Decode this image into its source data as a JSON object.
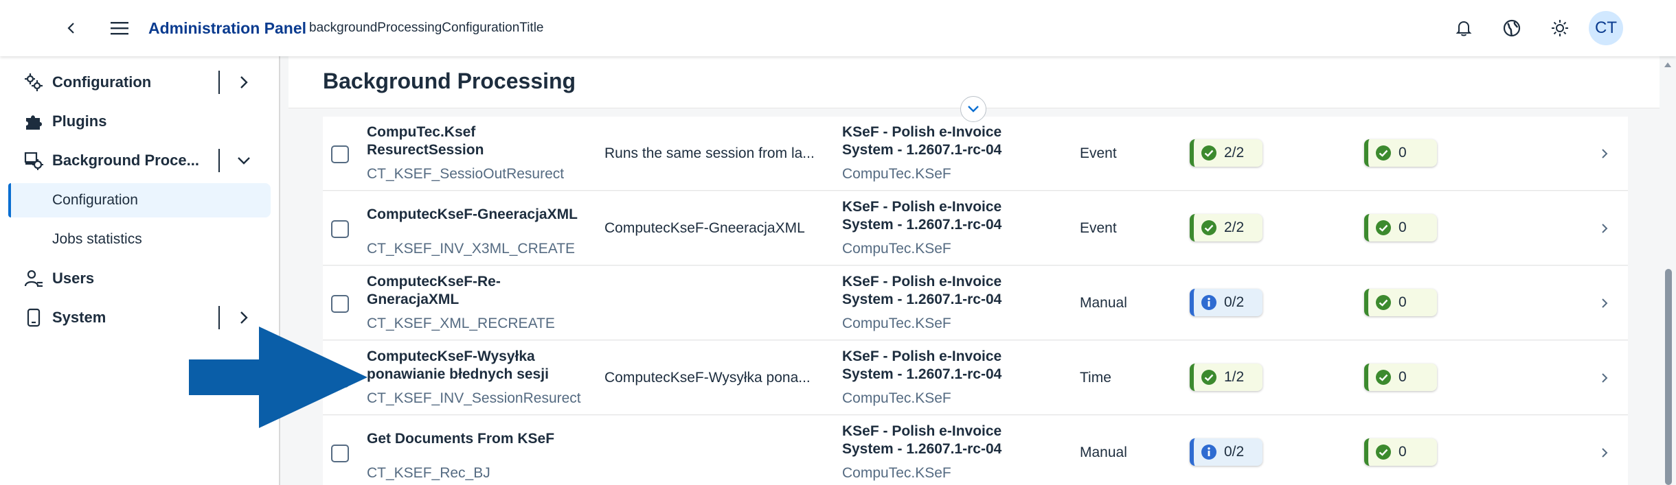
{
  "header": {
    "title": "Administration Panel",
    "subtitle": "backgroundProcessingConfigurationTitle",
    "avatar_initials": "CT",
    "icons": [
      "back-icon",
      "menu-icon",
      "bell-icon",
      "globe-icon",
      "sun-icon"
    ]
  },
  "sidebar": {
    "items": [
      {
        "label": "Configuration",
        "icon": "gears-icon"
      },
      {
        "label": "Plugins",
        "icon": "puzzle-icon"
      },
      {
        "label": "Background Proce...",
        "icon": "background-process-icon"
      },
      {
        "label": "Users",
        "icon": "user-icon"
      },
      {
        "label": "System",
        "icon": "device-icon"
      }
    ],
    "subitems": [
      {
        "label": "Configuration",
        "active": true
      },
      {
        "label": "Jobs statistics",
        "active": false
      }
    ]
  },
  "page": {
    "title": "Background Processing"
  },
  "table": {
    "rows": [
      {
        "name": "CompuTec.Ksef ResurectSession",
        "code": "CT_KSEF_SessioOutResurect",
        "description": "Runs the same session from la...",
        "package": "KSeF - Polish e-Invoice System - 1.2607.1-rc-04",
        "vendor": "CompuTec.KSeF",
        "trigger": "Event",
        "status1": {
          "text": "2/2",
          "kind": "ok"
        },
        "status2": {
          "text": "0",
          "kind": "ok"
        }
      },
      {
        "name": "ComputecKseF-GneeracjaXML",
        "code": "CT_KSEF_INV_X3ML_CREATE",
        "description": "ComputecKseF-GneeracjaXML",
        "package": "KSeF - Polish e-Invoice System - 1.2607.1-rc-04",
        "vendor": "CompuTec.KSeF",
        "trigger": "Event",
        "status1": {
          "text": "2/2",
          "kind": "ok"
        },
        "status2": {
          "text": "0",
          "kind": "ok"
        }
      },
      {
        "name": "ComputecKseF-Re-GneracjaXML",
        "code": "CT_KSEF_XML_RECREATE",
        "description": "",
        "package": "KSeF - Polish e-Invoice System - 1.2607.1-rc-04",
        "vendor": "CompuTec.KSeF",
        "trigger": "Manual",
        "status1": {
          "text": "0/2",
          "kind": "info"
        },
        "status2": {
          "text": "0",
          "kind": "ok"
        }
      },
      {
        "name": "ComputecKseF-Wysyłka ponawianie błednych sesji",
        "code": "CT_KSEF_INV_SessionResurect",
        "description": "ComputecKseF-Wysyłka pona...",
        "package": "KSeF - Polish e-Invoice System - 1.2607.1-rc-04",
        "vendor": "CompuTec.KSeF",
        "trigger": "Time",
        "status1": {
          "text": "1/2",
          "kind": "ok"
        },
        "status2": {
          "text": "0",
          "kind": "ok"
        }
      },
      {
        "name": "Get Documents From KSeF",
        "code": "CT_KSEF_Rec_BJ",
        "description": "",
        "package": "KSeF - Polish e-Invoice System - 1.2607.1-rc-04",
        "vendor": "CompuTec.KSeF",
        "trigger": "Manual",
        "status1": {
          "text": "0/2",
          "kind": "info"
        },
        "status2": {
          "text": "0",
          "kind": "ok"
        }
      }
    ]
  },
  "colors": {
    "brand": "#0a3b8f",
    "ok": "#3c8a2e",
    "info": "#2e6bd1",
    "arrow": "#0a5ea8"
  }
}
